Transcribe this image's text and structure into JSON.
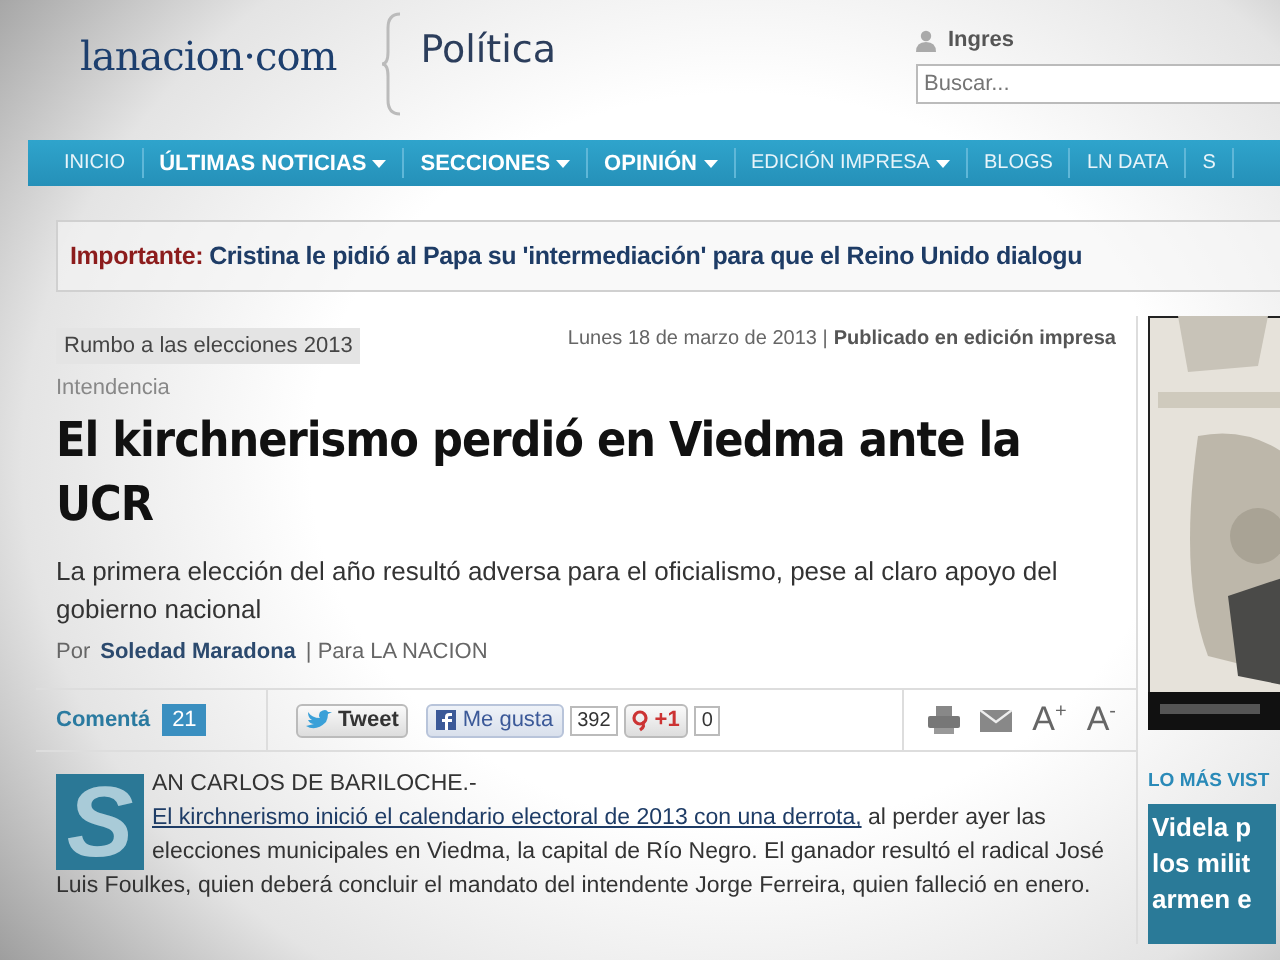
{
  "header": {
    "logo": "lanacion·com",
    "section": "Política",
    "login": "Ingres",
    "search": {
      "placeholder": "Buscar..."
    }
  },
  "nav": [
    {
      "label": "INICIO",
      "bold": false,
      "dropdown": false
    },
    {
      "label": "ÚLTIMAS NOTICIAS",
      "bold": true,
      "dropdown": true
    },
    {
      "label": "SECCIONES",
      "bold": true,
      "dropdown": true
    },
    {
      "label": "OPINIÓN",
      "bold": true,
      "dropdown": true
    },
    {
      "label": "EDICIÓN IMPRESA",
      "bold": false,
      "dropdown": true
    },
    {
      "label": "BLOGS",
      "bold": false,
      "dropdown": false
    },
    {
      "label": "LN DATA",
      "bold": false,
      "dropdown": false
    },
    {
      "label": "S",
      "bold": false,
      "dropdown": false
    }
  ],
  "alert": {
    "label": "Importante:",
    "text": "Cristina le pidió al Papa su 'intermediación' para que el Reino Unido dialogu"
  },
  "article": {
    "tag": "Rumbo a las elecciones 2013",
    "date": "Lunes 18 de marzo de 2013 |",
    "edition": "Publicado en edición impresa",
    "kicker": "Intendencia",
    "headline": "El kirchnerismo perdió en Viedma ante la UCR",
    "deck": "La primera elección del año resultó adversa para el oficialismo, pese al claro apoyo del gobierno nacional",
    "byline": {
      "prefix": "Por",
      "author": "Soledad Maradona",
      "source": "| Para LA NACION"
    },
    "share": {
      "comment": "Comentá",
      "comment_count": "21",
      "tweet": "Tweet",
      "like": "Me gusta",
      "like_count": "392",
      "plus": "+1",
      "plus_count": "0",
      "font_up": "A$^{+}$",
      "font_down": "A$^{-}$"
    },
    "body": {
      "dropcap": "S",
      "lead": "AN CARLOS DE BARILOCHE.- ",
      "link": "El kirchnerismo inició el calendario electoral de 2013 con una derrota,",
      "rest": " al perder ayer las elecciones municipales en Viedma, la capital de Río Negro. El ganador resultó el radical José Luis Foulkes, quien deberá concluir el mandato del intendente Jorge Ferreira, quien falleció en enero."
    }
  },
  "sidebar": {
    "most_viewed_title": "LO MÁS VIST",
    "top_story": [
      "Videla p",
      "los milit",
      "armen e"
    ]
  }
}
